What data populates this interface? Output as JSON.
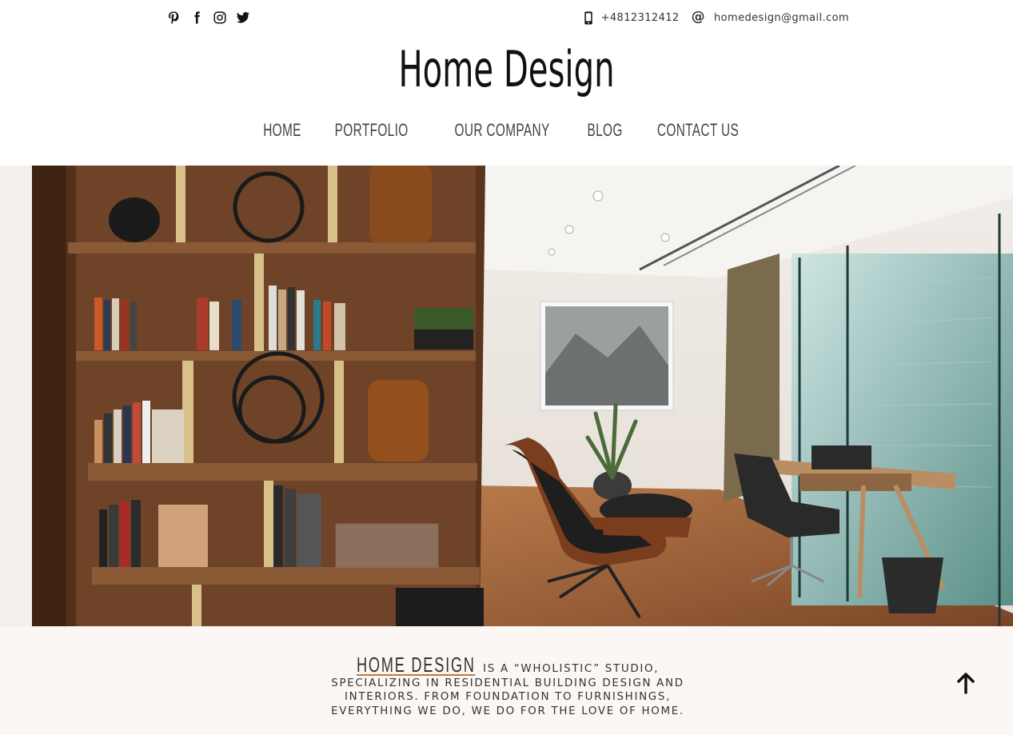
{
  "header": {
    "social": [
      {
        "icon": "pinterest-icon"
      },
      {
        "icon": "facebook-icon"
      },
      {
        "icon": "instagram-icon"
      },
      {
        "icon": "twitter-icon"
      }
    ],
    "phone": "+4812312412",
    "email": "homedesign@gmail.com"
  },
  "brand": {
    "title": "Home Design"
  },
  "nav": {
    "items": [
      "HOME",
      "PORTFOLIO",
      "OUR COMPANY",
      "BLOG",
      "CONTACT US"
    ]
  },
  "intro": {
    "brand": "HOME DESIGN",
    "text": "is a “wholistic” studio, specializing in residential building design and interiors. From foundation to furnishings, everything we do, we do for the love of home."
  },
  "colors": {
    "accent": "#c47a3a",
    "intro_bg": "#fcf7f4"
  }
}
